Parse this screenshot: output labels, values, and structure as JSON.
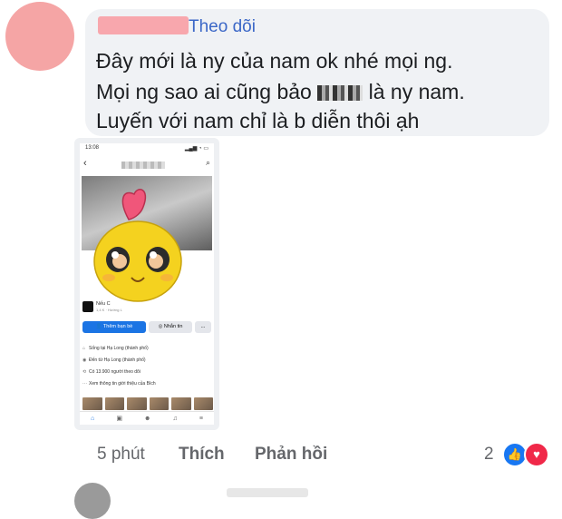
{
  "comment": {
    "follow_label": "Theo dõi",
    "line1": "Đây mới là ny của nam ok nhé mọi ng.",
    "line2_before": "Mọi ng sao ai cũng bảo",
    "line2_after": "là ny nam.",
    "line3": "Luyến với nam chỉ là b diễn thôi ạh"
  },
  "phone": {
    "status_time": "13:08",
    "page_name": "Nếu C",
    "page_sub": "1,4 K · Hướng L",
    "add_friend_label": "Thêm bạn bè",
    "message_label": "Nhắn tin",
    "more_label": "...",
    "info": [
      {
        "icon": "home-icon",
        "glyph": "⌂",
        "text": "Sống tại Hạ Long (thành phố)"
      },
      {
        "icon": "location-icon",
        "glyph": "◉",
        "text": "Đến từ Hạ Long (thành phố)"
      },
      {
        "icon": "followers-icon",
        "glyph": "⟲",
        "text": "Có 13.900 người theo dõi"
      },
      {
        "icon": "more-info-icon",
        "glyph": "···",
        "text": "Xem thông tin giới thiệu của Bích"
      }
    ],
    "nav": [
      "⌂",
      "▣",
      "☻",
      "♫",
      "≡"
    ]
  },
  "actions": {
    "time": "5 phút",
    "like_label": "Thích",
    "reply_label": "Phản hồi",
    "reaction_count": "2",
    "like_glyph": "👍",
    "love_glyph": "♥"
  },
  "colors": {
    "follow": "#3b67c7",
    "bubble": "#f0f2f5",
    "like_reaction": "#1877f2",
    "love_reaction": "#f02849"
  }
}
